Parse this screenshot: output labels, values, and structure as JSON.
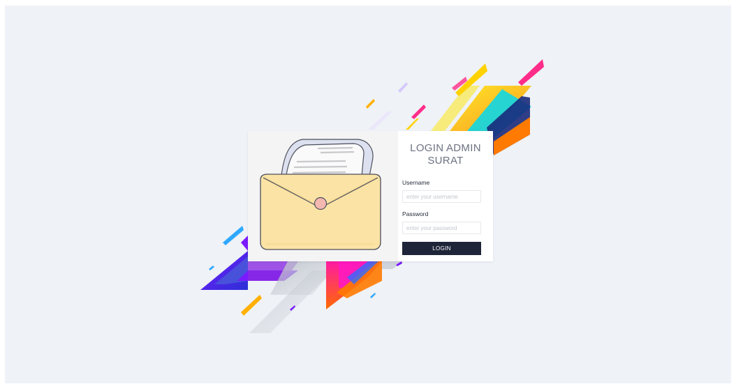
{
  "login": {
    "title_line1": "LOGIN ADMIN",
    "title_line2": "SURAT",
    "username_label": "Username",
    "username_placeholder": "enter your username",
    "password_label": "Password",
    "password_placeholder": "enter your password",
    "login_button": "LOGIN"
  },
  "illustration": {
    "icon": "envelope-letter-icon"
  },
  "colors": {
    "background": "#eff2f6",
    "button": "#1e2538",
    "envelope": "#fbe3a5",
    "seal": "#f4b8b0"
  }
}
